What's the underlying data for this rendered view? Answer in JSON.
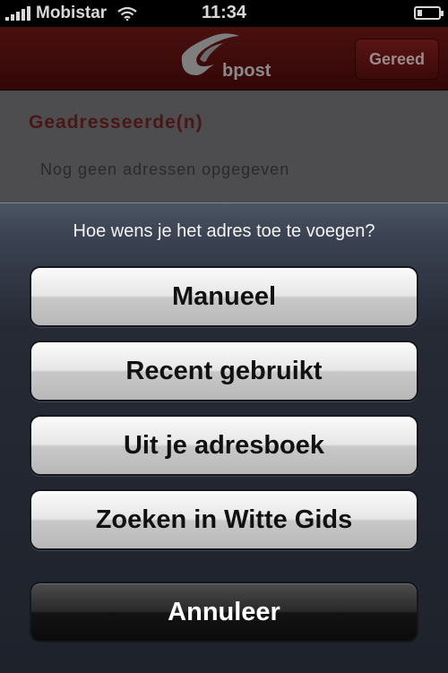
{
  "status_bar": {
    "carrier": "Mobistar",
    "time": "11:34",
    "signal_bars": 5,
    "battery_level": 0.2,
    "wifi_icon": "wifi-icon",
    "battery_icon": "battery-icon"
  },
  "nav_bar": {
    "logo_text": "bpost",
    "logo_icon": "bpost-horn-logo",
    "done_label": "Gereed",
    "bar_color": "#3d0a0a"
  },
  "content": {
    "section_title": "Geadresseerde(n)",
    "empty_text": "Nog geen adressen opgegeven"
  },
  "action_sheet": {
    "title": "Hoe wens je het adres toe te voegen?",
    "options": [
      {
        "label": "Manueel"
      },
      {
        "label": "Recent gebruikt"
      },
      {
        "label": "Uit je adresboek"
      },
      {
        "label": "Zoeken in Witte Gids"
      }
    ],
    "cancel_label": "Annuleer"
  }
}
